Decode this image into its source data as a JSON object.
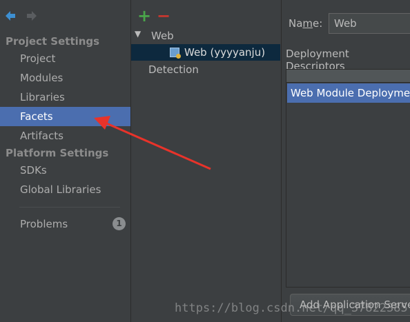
{
  "sidebar": {
    "section_project": "Project Settings",
    "project_items": [
      "Project",
      "Modules",
      "Libraries",
      "Facets",
      "Artifacts"
    ],
    "section_platform": "Platform Settings",
    "platform_items": [
      "SDKs",
      "Global Libraries"
    ],
    "problems_label": "Problems",
    "problems_count": "1",
    "selected": "Facets"
  },
  "toolbar": {
    "add": "+",
    "remove": "−"
  },
  "tree": {
    "root_label": "Web",
    "child_label": "Web (yyyyanju)",
    "detection_label": "Detection"
  },
  "details": {
    "name_label_prefix": "Na",
    "name_label_mnemonic": "m",
    "name_label_suffix": "e:",
    "name_value": "Web",
    "deployment_descriptors_label": "Deployment Descriptors",
    "descriptor_row": "Web Module Deployment Descriptor",
    "add_server_button": "Add Application Server specific descriptor..."
  },
  "watermark": "https://blog.csdn.net/qq_37822385",
  "colors": {
    "selection": "#4b6eaf",
    "tree_selection": "#0d293e",
    "annotation_arrow": "#e8332a",
    "add_green": "#4aa54a",
    "remove_red": "#c7372f"
  }
}
